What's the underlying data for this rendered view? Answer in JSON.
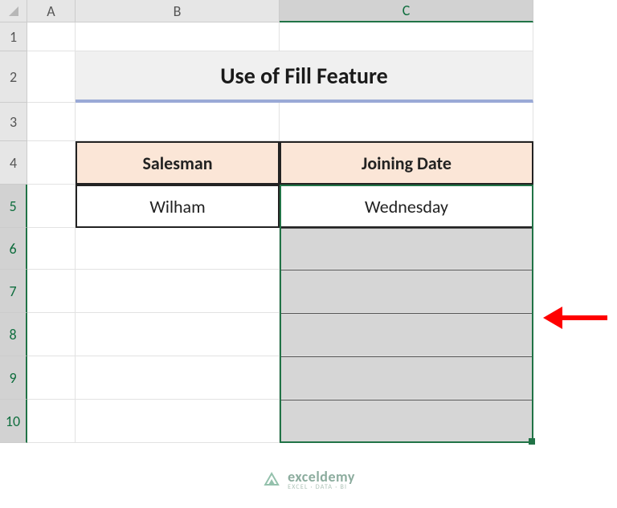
{
  "columns": {
    "A": "A",
    "B": "B",
    "C": "C"
  },
  "rows": {
    "r1": "1",
    "r2": "2",
    "r3": "3",
    "r4": "4",
    "r5": "5",
    "r6": "6",
    "r7": "7",
    "r8": "8",
    "r9": "9",
    "r10": "10"
  },
  "title": "Use of Fill Feature",
  "table": {
    "headers": {
      "salesman": "Salesman",
      "joining_date": "Joining Date"
    },
    "rows": [
      {
        "salesman": "Wilham",
        "joining_date": "Wednesday"
      }
    ]
  },
  "selection": {
    "range": "C5:C10",
    "fill_cells": [
      "",
      "",
      "",
      "",
      ""
    ]
  },
  "watermark": {
    "main": "exceldemy",
    "sub": "EXCEL · DATA · BI"
  }
}
